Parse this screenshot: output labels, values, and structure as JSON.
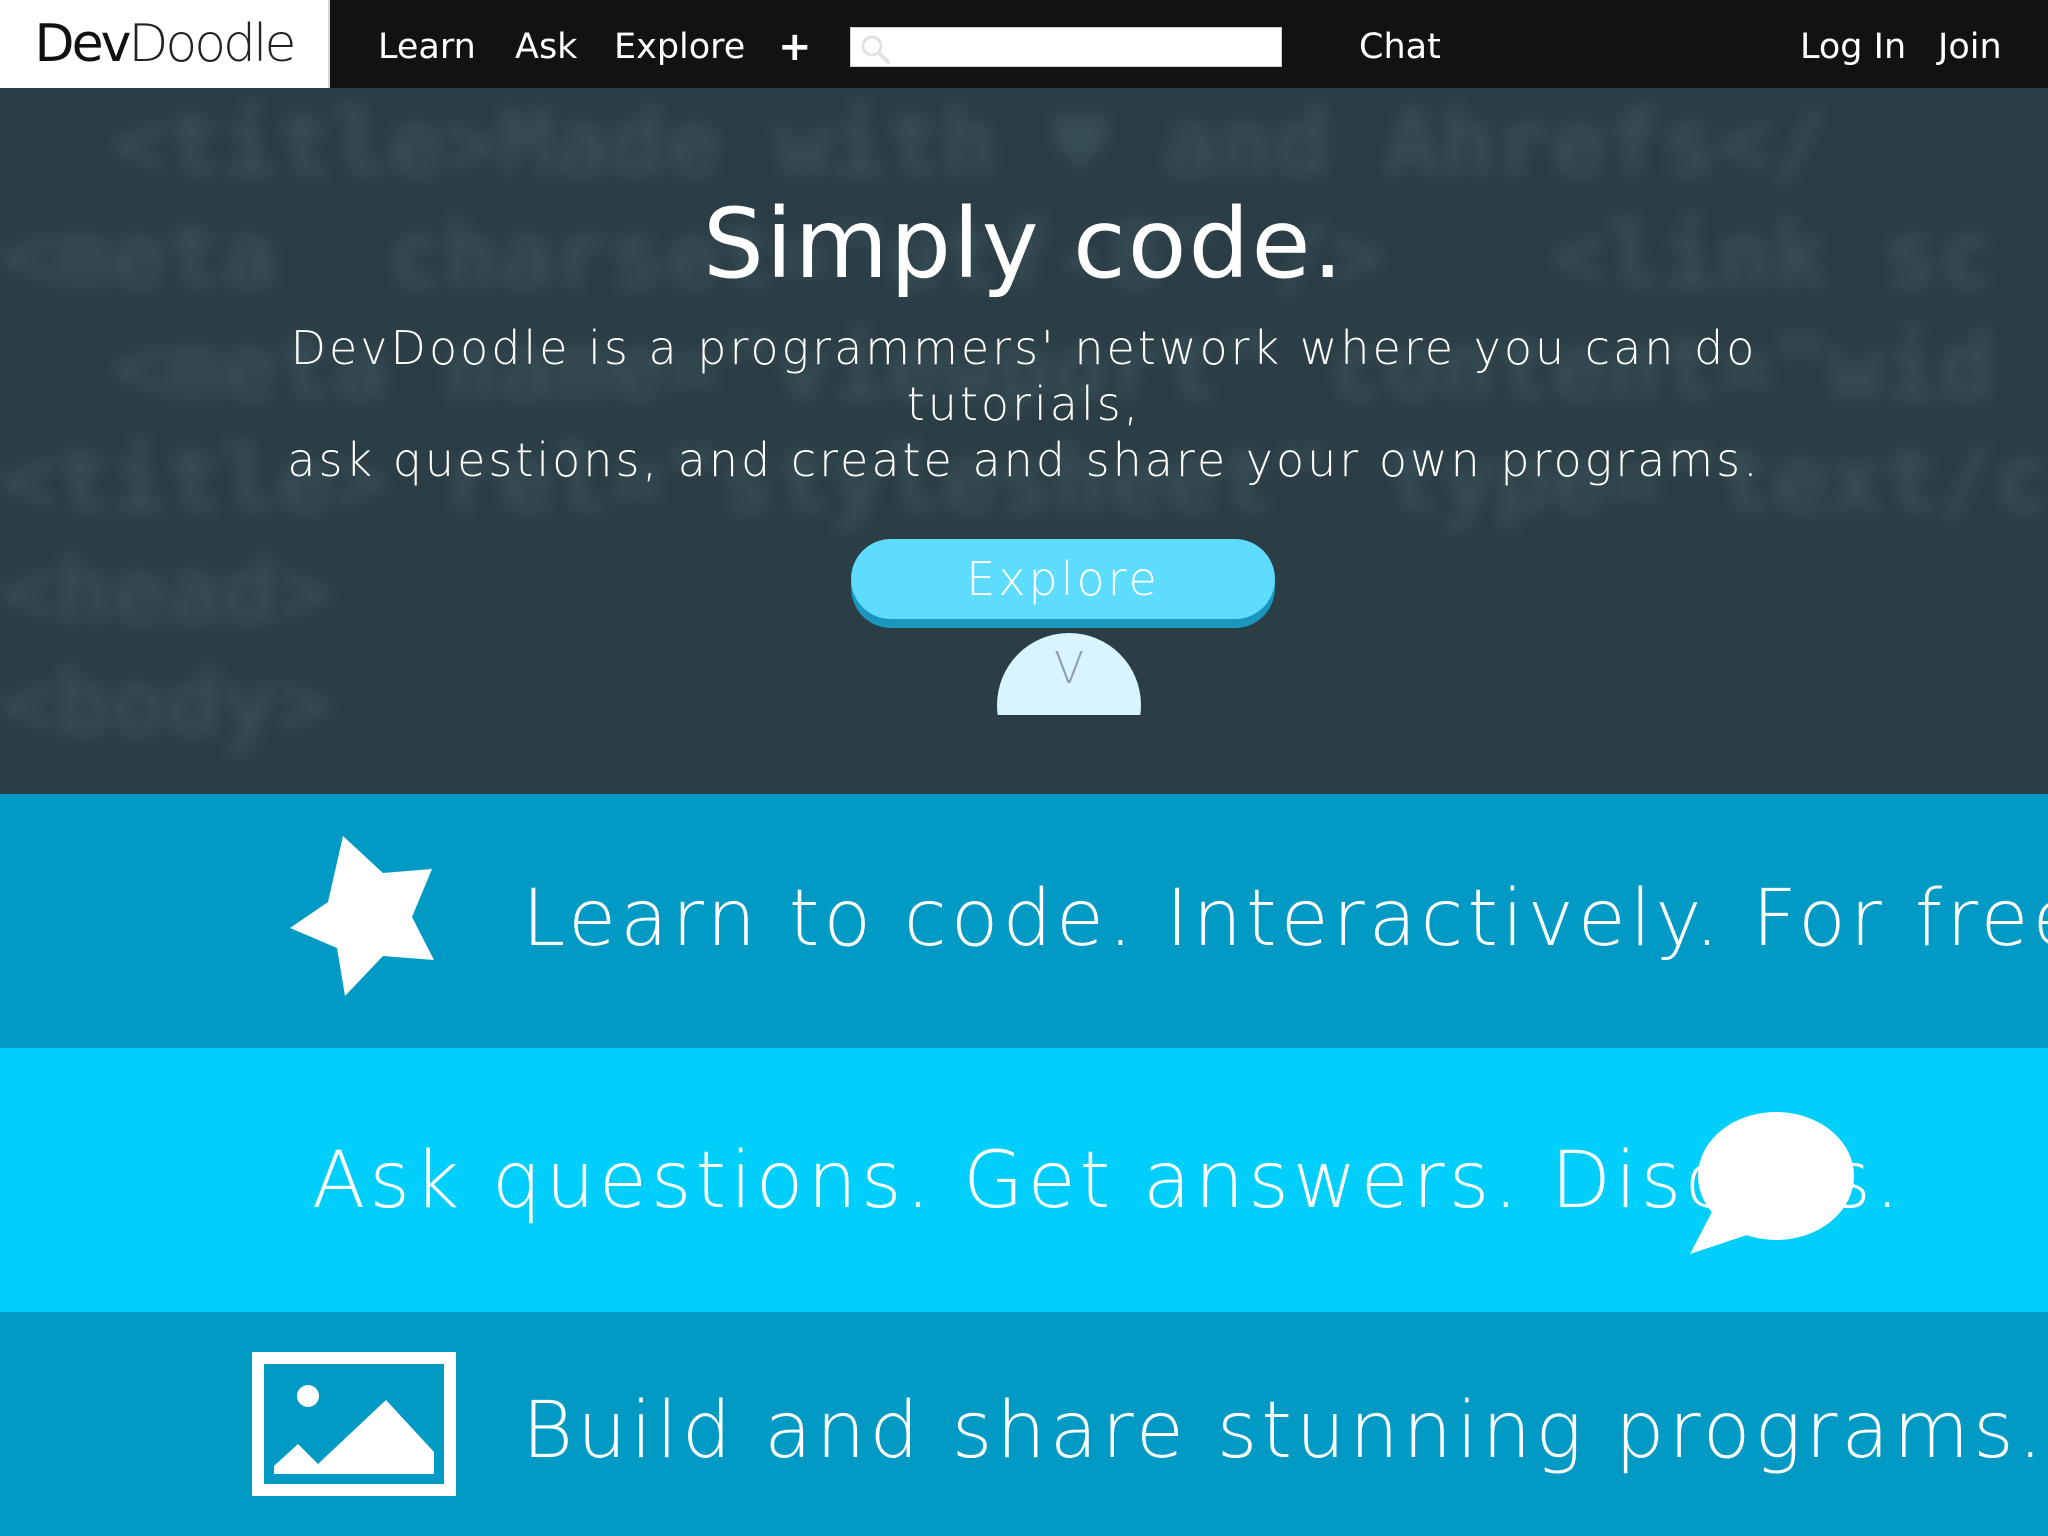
{
  "nav": {
    "logo_dev": "Dev",
    "logo_doodle": "Doodle",
    "links": [
      "Learn",
      "Ask",
      "Explore"
    ],
    "plus": "+",
    "search_placeholder": "",
    "chat": "Chat",
    "login": "Log In",
    "join": "Join"
  },
  "hero": {
    "title": "Simply code.",
    "subtitle_line1": "DevDoodle is a programmers' network where you can do tutorials,",
    "subtitle_line2": "ask questions, and create and share your own programs.",
    "explore_button": "Explore",
    "scroll_glyph": "V"
  },
  "features": {
    "learn": "Learn to code. Interactively. For free.",
    "ask": "Ask questions. Get answers. Discuss.",
    "build": "Build and share stunning programs."
  },
  "colors": {
    "nav_bg": "#121212",
    "hero_bg": "#2c3e45",
    "band_dark": "#009ac4",
    "band_light": "#00cffc",
    "button": "#5ddcfd",
    "button_shadow": "#1a97bf"
  },
  "icons": {
    "learn": "star-icon",
    "ask": "speech-bubble-icon",
    "build": "image-icon",
    "search": "search-icon"
  }
}
